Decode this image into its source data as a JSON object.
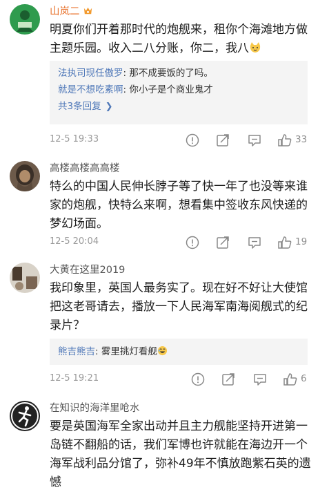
{
  "comments": [
    {
      "username": "山岚二",
      "text": "明夏你们开着那时代的炮舰来，租你个海滩地方做主题乐园。收入二八分账，你二，我八",
      "replies": [
        {
          "name": "法执司现任傲罗",
          "text": "那不成要饭的了吗。"
        },
        {
          "name": "就是不想吃素啊",
          "text": "你小子是个商业鬼才"
        }
      ],
      "more_replies": "共3条回复",
      "time": "12-5 19:33",
      "likes": "33"
    },
    {
      "username": "高楼高楼高高楼",
      "text": "特么的中国人民伸长脖子等了快一年了也没等来谁家的炮舰，快特么来啊，想看集中签收东风快递的梦幻场面。",
      "time": "12-5 20:04",
      "likes": "19"
    },
    {
      "username": "大黄在这里2019",
      "text": "我印象里，英国人最务实了。现在好不好让大使馆把这老哥请去，播放一下人民海军南海阅舰式的纪录片？",
      "replies": [
        {
          "name": "熊吉熊吉",
          "text": "雾里挑灯看舰"
        }
      ],
      "time": "12-5 19:21",
      "likes": "6"
    },
    {
      "username": "在知识的海洋里呛水",
      "text": "要是英国海军全家出动并且主力舰能坚持开进第一岛链不翻船的话，我们军博也许就能在海边开一个海军战利品分馆了，弥补49年不慎放跑紫石英的遗憾"
    }
  ],
  "colors": {
    "username_highlight": "#e8712b",
    "reply_name": "#4e77b8",
    "meta_gray": "#9a9a9a"
  },
  "icons": [
    "vip-badge-icon",
    "cat-emoji-icon",
    "report-icon",
    "share-icon",
    "comment-icon",
    "like-icon",
    "laugh-emoji-icon",
    "chevron-right-icon"
  ]
}
